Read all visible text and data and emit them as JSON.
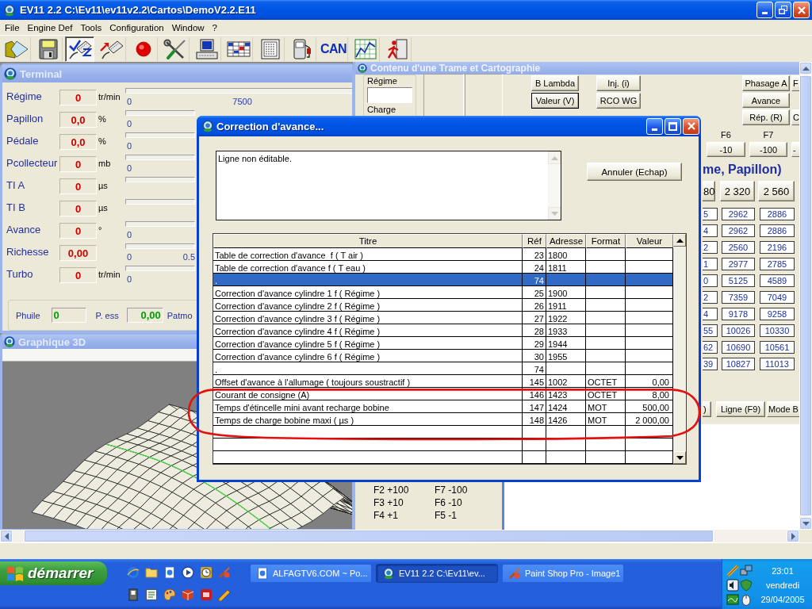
{
  "app": {
    "title": "EV11 2.2 C:\\Ev11\\ev11v2.2\\Cartos\\DemoV2.2.E11",
    "menu": [
      "File",
      "Engine Def",
      "Tools",
      "Configuration",
      "Window",
      "?"
    ]
  },
  "toolbar": [
    {
      "pressed": false
    },
    {
      "pressed": false
    },
    {
      "pressed": true
    },
    {
      "pressed": false
    },
    {
      "pressed": false
    },
    {
      "pressed": false
    },
    {
      "pressed": false
    },
    {
      "pressed": false
    },
    {
      "pressed": false
    },
    {
      "pressed": false
    },
    {
      "label": "CAN",
      "pressed": false
    },
    {
      "pressed": false
    },
    {
      "pressed": false
    }
  ],
  "terminal": {
    "title": "Terminal",
    "rows": [
      {
        "label": "Régime",
        "value": "0",
        "unit": "tr/min",
        "level": 0,
        "min": "0",
        "max": "7500"
      },
      {
        "label": "Papillon",
        "value": "0,0",
        "unit": "%",
        "level": 0,
        "min": "0"
      },
      {
        "label": "Pédale",
        "value": "0,0",
        "unit": "%",
        "level": 0,
        "min": "0"
      },
      {
        "label": "Pcollecteur",
        "value": "0",
        "unit": "mb",
        "level": 0,
        "min": "0"
      },
      {
        "label": "TI A",
        "value": "0",
        "unit": "µs",
        "level": 0
      },
      {
        "label": "TI B",
        "value": "0",
        "unit": "µs",
        "level": 0
      },
      {
        "label": "Avance",
        "value": "0",
        "unit": "°",
        "level": 0,
        "min": "0"
      },
      {
        "label": "Richesse",
        "value": "0,00",
        "level": 0,
        "min": "0",
        "max": "0.5"
      },
      {
        "label": "Turbo",
        "value": "0",
        "unit": "tr/min",
        "level": 0,
        "min": "0"
      }
    ],
    "footer": [
      {
        "label": "Phuile",
        "value": "0"
      },
      {
        "label": "P. ess",
        "value": "0,00"
      },
      {
        "label": "Patmo"
      }
    ]
  },
  "graph_window": {
    "title": "Graphique 3D"
  },
  "map_window": {
    "title": "Contenu d'une Trame et Cartographie",
    "regime_label": "Régime",
    "charge_label": "Charge",
    "button_columns": [
      [
        {
          "label": "B Lambda",
          "default": false
        },
        {
          "label": "Valeur (V)",
          "default": true
        }
      ],
      [
        {
          "label": "Inj. (i)",
          "default": false
        },
        {
          "label": "RCO WG",
          "default": false
        }
      ],
      [
        {
          "label": "Phasage A",
          "default": false
        },
        {
          "label": "Avance",
          "default": false
        },
        {
          "label": "Rép. (R)",
          "default": false
        }
      ],
      [
        {
          "label": "F",
          "default": false
        },
        {
          "label": "C",
          "default": false
        }
      ]
    ],
    "function_keys": [
      {
        "key": "F6",
        "label": "-10"
      },
      {
        "key": "F7",
        "label": "-100"
      },
      {
        "label": "-"
      }
    ],
    "heading": "me, Papillon)",
    "grid": {
      "columns": [
        "80",
        "2 320",
        "2 560"
      ],
      "rows": [
        [
          "5",
          "2962",
          "2886"
        ],
        [
          "4",
          "2962",
          "2886"
        ],
        [
          "2",
          "2560",
          "2196"
        ],
        [
          "1",
          "2977",
          "2785"
        ],
        [
          "0",
          "5125",
          "4589"
        ],
        [
          "2",
          "7359",
          "7049"
        ],
        [
          "4",
          "9178",
          "9258"
        ],
        [
          "55",
          "10026",
          "10330"
        ],
        [
          "62",
          "10690",
          "10561"
        ],
        [
          "39",
          "10827",
          "11013"
        ]
      ]
    },
    "bottom_buttons": [
      ")",
      "Ligne (F9)",
      "Mode B"
    ],
    "legend": [
      [
        "F2 +100",
        "F7 -100"
      ],
      [
        "F3 +10",
        "F6 -10"
      ],
      [
        "F4 +1",
        "F5 -1"
      ]
    ]
  },
  "dialog": {
    "title": "Correction d'avance...",
    "message": "Ligne non éditable.",
    "cancel_button": "Annuler (Echap)",
    "table": {
      "columns": [
        "Titre",
        "Réf",
        "Adresse",
        "Format",
        "Valeur"
      ],
      "rows": [
        {
          "title": "Table de correction d'avance  f ( T air )",
          "ref": "23",
          "address": "1800",
          "selected": false
        },
        {
          "title": "Table de correction d'avance f ( T eau )",
          "ref": "24",
          "address": "1811",
          "selected": false
        },
        {
          "title": ".",
          "ref": "74",
          "selected": true
        },
        {
          "title": "Correction d'avance cylindre 1 f ( Régime )",
          "ref": "25",
          "address": "1900",
          "selected": false
        },
        {
          "title": "Correction d'avance cylindre 2 f ( Régime )",
          "ref": "26",
          "address": "1911",
          "selected": false
        },
        {
          "title": "Correction d'avance cylindre 3 f ( Régime )",
          "ref": "27",
          "address": "1922",
          "selected": false
        },
        {
          "title": "Correction d'avance cylindre 4 f ( Régime )",
          "ref": "28",
          "address": "1933",
          "selected": false
        },
        {
          "title": "Correction d'avance cylindre 5 f ( Régime )",
          "ref": "29",
          "address": "1944",
          "selected": false
        },
        {
          "title": "Correction d'avance cylindre 6 f ( Régime )",
          "ref": "30",
          "address": "1955",
          "selected": false
        },
        {
          "title": ".",
          "ref": "74",
          "selected": false
        },
        {
          "title": "Offset d'avance à l'allumage ( toujours soustractif )",
          "ref": "145",
          "address": "1002",
          "format": "OCTET",
          "value": "0,00",
          "selected": false
        },
        {
          "title": "Courant de consigne (A)",
          "ref": "146",
          "address": "1423",
          "format": "OCTET",
          "value": "8,00",
          "selected": false
        },
        {
          "title": "Temps d'étincelle mini avant recharge bobine",
          "ref": "147",
          "address": "1424",
          "format": "MOT",
          "value": "500,00",
          "selected": false
        },
        {
          "title": "Temps de charge bobine maxi ( µs )",
          "ref": "148",
          "address": "1426",
          "format": "MOT",
          "value": "2 000,00",
          "selected": false
        }
      ]
    }
  },
  "taskbar": {
    "start": "démarrer",
    "tasks": [
      {
        "label": "ALFAGTV6.COM ~ Po...",
        "selected": false
      },
      {
        "label": "EV11 2.2 C:\\Ev11\\ev...",
        "selected": true
      },
      {
        "label": "Paint Shop Pro - Image1",
        "selected": false
      }
    ],
    "clock": {
      "time": "23:01",
      "day": "vendredi",
      "date": "29/04/2005"
    }
  }
}
